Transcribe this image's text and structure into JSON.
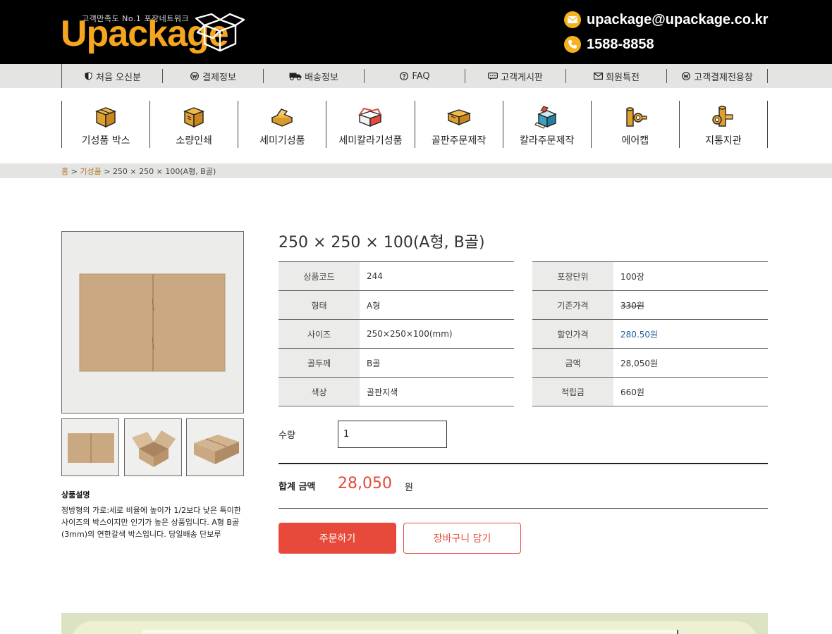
{
  "header": {
    "logo_tagline": "고객만족도 No.1  포장네트워크",
    "logo_word": "Upackage",
    "email": "upackage@upackage.co.kr",
    "phone": "1588-8858"
  },
  "subnav": [
    {
      "label": "처음 오신분",
      "icon": "shield-icon"
    },
    {
      "label": "결제정보",
      "icon": "won-icon"
    },
    {
      "label": "배송정보",
      "icon": "truck-icon"
    },
    {
      "label": "FAQ",
      "icon": "question-icon"
    },
    {
      "label": "고객게시판",
      "icon": "chat-icon"
    },
    {
      "label": "회원특전",
      "icon": "mail-icon"
    },
    {
      "label": "고객결제전용창",
      "icon": "won-icon"
    }
  ],
  "categories": [
    {
      "label": "기성품 박스"
    },
    {
      "label": "소량인쇄"
    },
    {
      "label": "세미기성품"
    },
    {
      "label": "세미칼라기성품"
    },
    {
      "label": "골판주문제작"
    },
    {
      "label": "칼라주문제작"
    },
    {
      "label": "에어캡"
    },
    {
      "label": "지통지관"
    }
  ],
  "breadcrumb": {
    "home": "홈",
    "sep1": " > ",
    "category": "기성품",
    "sep2": " > ",
    "current": "250 × 250 × 100(A형, B골)"
  },
  "product": {
    "title": "250 × 250 × 100(A형, B골)",
    "desc_title": "상품설명",
    "desc_text": "정방형의 가로:세로 비율에 높이가 1/2보다 낮은 특이한 사이즈의 박스이지만 인기가 높은 상품입니다. A형 B골(3mm)의 연한갈색 박스입니다. 당일배송 단보루",
    "specs_left": [
      {
        "key": "상품코드",
        "value": "244"
      },
      {
        "key": "형태",
        "value": "A형"
      },
      {
        "key": "사이즈",
        "value": "250×250×100(mm)"
      },
      {
        "key": "골두께",
        "value": "B골"
      },
      {
        "key": "색상",
        "value": "골판지색"
      }
    ],
    "specs_right": [
      {
        "key": "포장단위",
        "value": "100장"
      },
      {
        "key": "기존가격",
        "value": "330원"
      },
      {
        "key": "할인가격",
        "value": "280.50원"
      },
      {
        "key": "금액",
        "value": "28,050원"
      },
      {
        "key": "적립금",
        "value": "660원"
      }
    ]
  },
  "order": {
    "qty_label": "수량",
    "qty_value": "1",
    "total_label": "합계 금액",
    "total_value": "28,050",
    "total_unit": "원",
    "order_button": "주문하기",
    "cart_button": "장바구니 담기"
  },
  "colors": {
    "brand": "#f5a51e",
    "accent": "#e74a3b",
    "sale_price": "#1d5fa0"
  }
}
